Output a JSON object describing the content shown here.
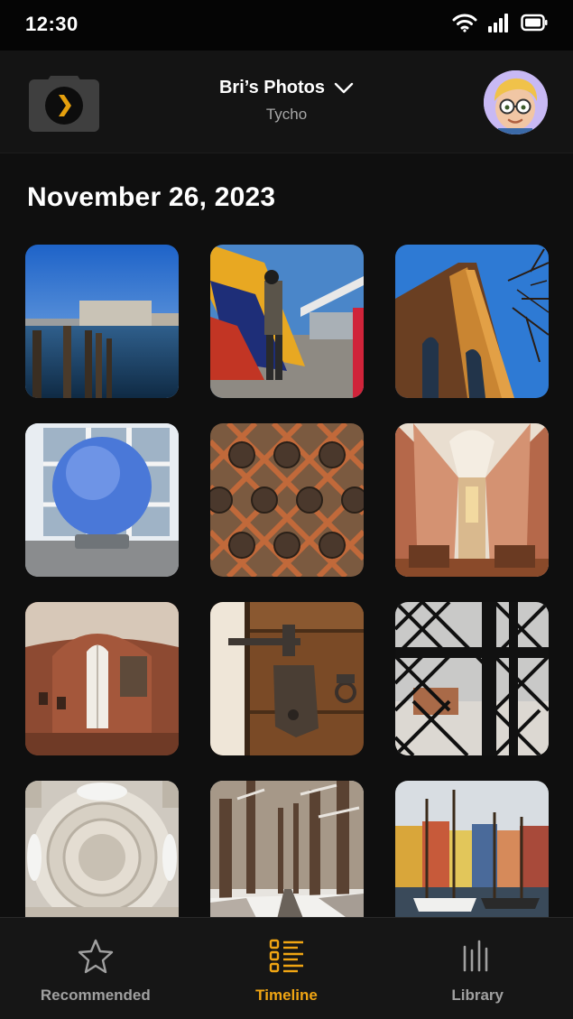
{
  "status_bar": {
    "time": "12:30",
    "icons": [
      "wifi-icon",
      "signal-icon",
      "battery-icon"
    ]
  },
  "header": {
    "app_icon": "plex-camera-icon",
    "album_title": "Bri’s Photos",
    "album_subtitle": "Tycho",
    "dropdown_icon": "chevron-down-icon",
    "avatar": "memoji-avatar"
  },
  "timeline": {
    "date_heading": "November 26, 2023",
    "photos": [
      "harbor-waterfront-photo",
      "person-with-flag-on-bridge-photo",
      "brick-church-tower-photo",
      "glass-sphere-window-photo",
      "ornate-metal-lattice-photo",
      "cathedral-nave-photo",
      "brick-chapel-interior-photo",
      "old-wooden-door-hinge-photo",
      "snowy-window-lattice-photo",
      "domed-ceiling-photo",
      "snowy-forest-path-photo",
      "nyhavn-canal-photo"
    ]
  },
  "tabs": [
    {
      "label": "Recommended",
      "icon": "star-icon",
      "active": false
    },
    {
      "label": "Timeline",
      "icon": "timeline-list-icon",
      "active": true
    },
    {
      "label": "Library",
      "icon": "library-icon",
      "active": false
    }
  ],
  "colors": {
    "accent": "#f0a513",
    "background": "#0f0f0f",
    "inactive": "#a0a0a0"
  }
}
